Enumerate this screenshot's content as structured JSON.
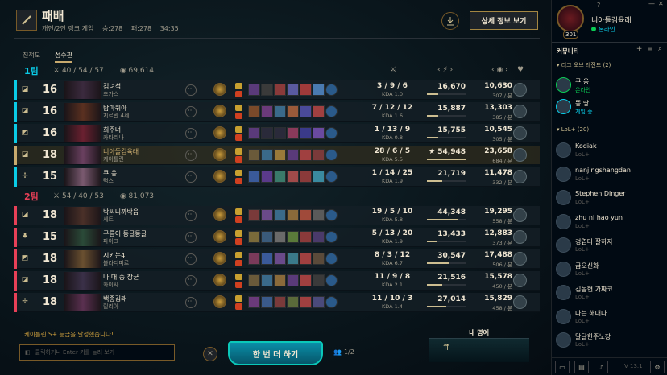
{
  "header": {
    "title": "패배",
    "mode": "개인/2인 랭크 게임",
    "wins": "승:278",
    "losses": "패:278",
    "duration": "34:35",
    "detail_button": "상세 정보 보기"
  },
  "tabs": [
    {
      "label": "진척도",
      "active": false
    },
    {
      "label": "점수판",
      "active": true
    }
  ],
  "teams": [
    {
      "name": "1팀",
      "color": "#0acbe6",
      "kda": "40 / 54 / 57",
      "gold": "69,614",
      "players": [
        {
          "level": "16",
          "pos": "◪",
          "name": "김녀석",
          "champion": "초가스",
          "kda": "3 / 9 / 6",
          "ratio": "KDA 1.0",
          "damage": "16,670",
          "dmg_frac": 0.3,
          "gold": "10,630",
          "gpm": "307 / 분",
          "champ_color": "#3b2a3e",
          "items": [
            "#5a3a7a",
            "#3a3a3a",
            "#8a3a3a",
            "#5a5aa0",
            "#a03a3a",
            "#4a7ab0"
          ]
        },
        {
          "level": "16",
          "pos": "◪",
          "name": "탐마쿼아",
          "champion": "지르반 4세",
          "kda": "7 / 12 / 12",
          "ratio": "KDA 1.6",
          "damage": "15,887",
          "dmg_frac": 0.29,
          "gold": "13,303",
          "gpm": "385 / 분",
          "champ_color": "#5a3020",
          "items": [
            "#7a4a2a",
            "#6a3a7a",
            "#3a6a8a",
            "#9a5a3a",
            "#4a4a9a",
            "#a04040"
          ]
        },
        {
          "level": "16",
          "pos": "◩",
          "name": "희주녀",
          "champion": "카타리나",
          "kda": "1 / 13 / 9",
          "ratio": "KDA 0.8",
          "damage": "15,755",
          "dmg_frac": 0.29,
          "gold": "10,545",
          "gpm": "305 / 분",
          "champ_color": "#6a2030",
          "items": [
            "#5a3a7a",
            "#2a2a3a",
            "#2a2a3a",
            "#8a3a5a",
            "#3a3a8a",
            "#6a4aa0"
          ]
        },
        {
          "level": "18",
          "pos": "◪",
          "name": "니아돌김육래",
          "champion": "케이틀린",
          "kda": "28 / 6 / 5",
          "ratio": "KDA 5.5",
          "damage": "★ 54,948",
          "dmg_frac": 1.0,
          "gold": "23,658",
          "gpm": "684 / 분",
          "champ_color": "#6a4060",
          "items": [
            "#6a5a3a",
            "#3a6a8a",
            "#9a7a3a",
            "#5a3a7a",
            "#a04040",
            "#7a3a3a"
          ],
          "me": true
        },
        {
          "level": "15",
          "pos": "✢",
          "name": "쿠 옹",
          "champion": "럭스",
          "kda": "1 / 14 / 25",
          "ratio": "KDA 1.9",
          "damage": "21,719",
          "dmg_frac": 0.4,
          "gold": "11,478",
          "gpm": "332 / 분",
          "champ_color": "#7a5a70",
          "items": [
            "#3a5a9a",
            "#5a3a8a",
            "#3a7a6a",
            "#a04a4a",
            "#8a3a3a",
            "#3a8aa0"
          ]
        }
      ]
    },
    {
      "name": "2팀",
      "color": "#e84057",
      "kda": "54 / 40 / 53",
      "gold": "81,073",
      "players": [
        {
          "level": "18",
          "pos": "◪",
          "name": "박씨니까박읍",
          "champion": "세트",
          "kda": "19 / 5 / 10",
          "ratio": "KDA 5.8",
          "damage": "44,348",
          "dmg_frac": 0.81,
          "gold": "19,295",
          "gpm": "558 / 분",
          "champ_color": "#4a3028",
          "items": [
            "#7a3a3a",
            "#6a4a8a",
            "#3a6a8a",
            "#8a6a3a",
            "#a04a3a",
            "#5a5a5a"
          ]
        },
        {
          "level": "15",
          "pos": "♣",
          "name": "구름이 둥글둥글",
          "champion": "파이크",
          "kda": "5 / 13 / 20",
          "ratio": "KDA 1.9",
          "damage": "13,433",
          "dmg_frac": 0.24,
          "gold": "12,883",
          "gpm": "373 / 분",
          "champ_color": "#2a4a38",
          "items": [
            "#7a6a3a",
            "#3a5a7a",
            "#6a6a6a",
            "#5a7a3a",
            "#8a3a3a",
            "#4a3a6a"
          ]
        },
        {
          "level": "18",
          "pos": "◩",
          "name": "시키는4",
          "champion": "블라디미르",
          "kda": "8 / 3 / 12",
          "ratio": "KDA 6.7",
          "damage": "30,547",
          "dmg_frac": 0.56,
          "gold": "17,488",
          "gpm": "506 / 분",
          "champ_color": "#6a5030",
          "items": [
            "#7a3a5a",
            "#3a5a9a",
            "#6a4a8a",
            "#3a7a8a",
            "#a04040",
            "#5a4a3a"
          ]
        },
        {
          "level": "18",
          "pos": "◪",
          "name": "나 대 승 장군",
          "champion": "카이사",
          "kda": "11 / 9 / 8",
          "ratio": "KDA 2.1",
          "damage": "21,516",
          "dmg_frac": 0.39,
          "gold": "15,578",
          "gpm": "450 / 분",
          "champ_color": "#3a3048",
          "items": [
            "#6a5a3a",
            "#3a6a8a",
            "#8a6a3a",
            "#5a3a7a",
            "#a04040",
            "#3a3a3a"
          ]
        },
        {
          "level": "18",
          "pos": "✢",
          "name": "백종김래",
          "champion": "릴리아",
          "kda": "11 / 10 / 3",
          "ratio": "KDA 1.4",
          "damage": "27,014",
          "dmg_frac": 0.49,
          "gold": "15,829",
          "gpm": "458 / 분",
          "champ_color": "#5a3050",
          "items": [
            "#6a3a7a",
            "#3a5a8a",
            "#7a3a3a",
            "#5a6a3a",
            "#a04040",
            "#4a4a7a"
          ]
        }
      ]
    }
  ],
  "footer": {
    "achievement": "케이틀린 S+ 등급을 달성했습니다!",
    "chat_placeholder": "클릭하거나 Enter 키를 눌러 보기",
    "play_again": "한 번 더 하기",
    "party": "1/2",
    "honor_title": "내 명예"
  },
  "rail": {
    "profile_name": "니아돌김육래",
    "profile_status": "온라인",
    "profile_level": "301",
    "community_label": "커뮤니티",
    "group1": "▾ 리그 오브 레전드 (2)",
    "group2": "▾ LoL+ (20)",
    "friends_lol": [
      {
        "name": "쿠 옹",
        "status": "온라인",
        "color": "#0acb54"
      },
      {
        "name": "똥 땅",
        "status": "게임 중",
        "color": "#0acbe6"
      }
    ],
    "friends_plus": [
      {
        "name": "Kodiak",
        "status": "LoL+"
      },
      {
        "name": "nanjingshangdan",
        "status": "LoL+"
      },
      {
        "name": "Stephen Dinger",
        "status": "LoL+"
      },
      {
        "name": "zhu ni hao yun",
        "status": "LoL+"
      },
      {
        "name": "경엽다 잘하자",
        "status": "LoL+"
      },
      {
        "name": "금오신화",
        "status": "LoL+"
      },
      {
        "name": "김동현 가짜코",
        "status": "LoL+"
      },
      {
        "name": "나는 해내다",
        "status": "LoL+"
      },
      {
        "name": "달달한주노장",
        "status": "LoL+"
      }
    ],
    "version": "V 13.1"
  }
}
